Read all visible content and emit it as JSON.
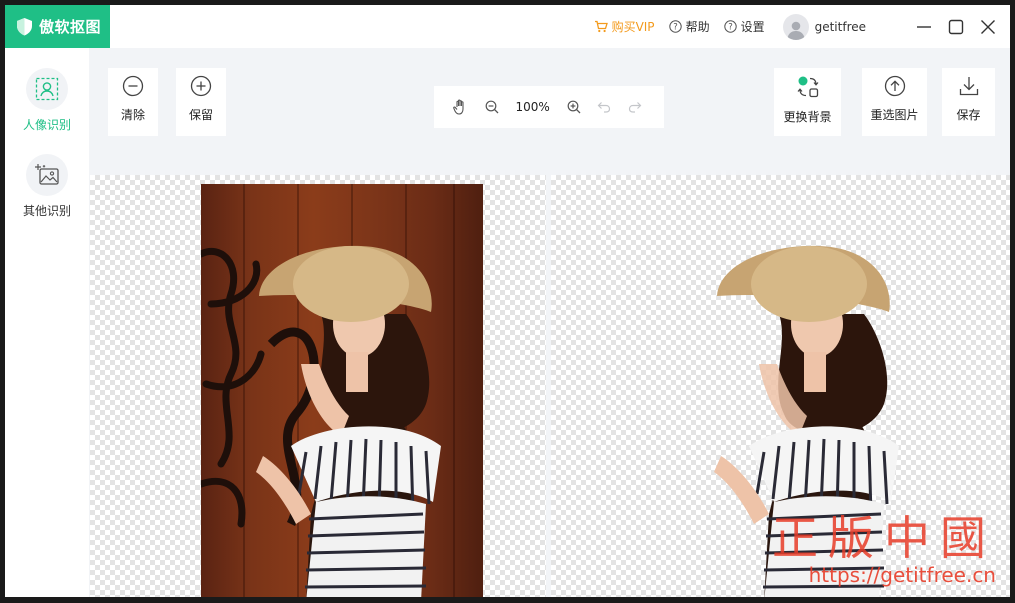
{
  "app": {
    "name": "傲软抠图",
    "brand_color": "#1fbf86"
  },
  "titlebar": {
    "vip": "购买VIP",
    "help": "帮助",
    "settings": "设置",
    "username": "getitfree"
  },
  "sidebar": {
    "items": [
      {
        "label": "人像识别",
        "icon": "portrait-scan-icon",
        "active": true
      },
      {
        "label": "其他识别",
        "icon": "image-sparkle-icon",
        "active": false
      }
    ]
  },
  "toolbar": {
    "clear": "清除",
    "keep": "保留",
    "zoom": "100%",
    "change_bg": "更换背景",
    "reselect": "重选图片",
    "save": "保存"
  },
  "watermark": {
    "big": "正版中國",
    "url": "https://getitfree.cn"
  }
}
